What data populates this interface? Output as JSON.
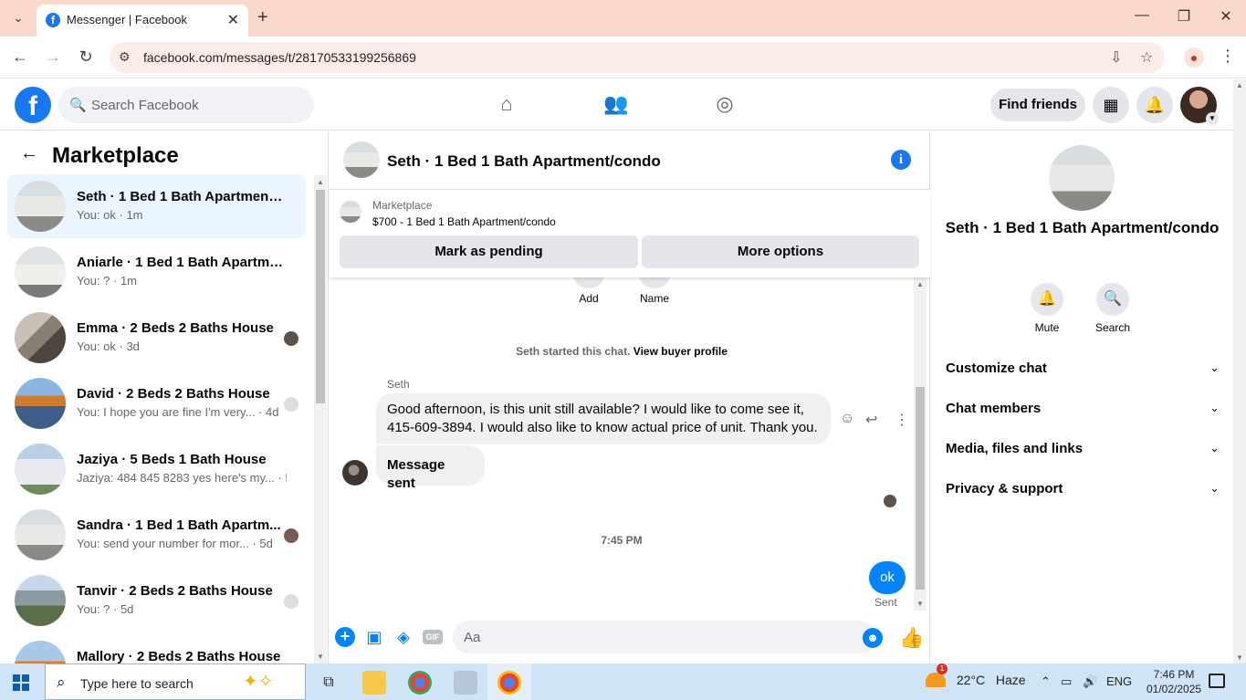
{
  "browser": {
    "tab_title": "Messenger | Facebook",
    "url": "facebook.com/messages/t/28170533199256869"
  },
  "fb": {
    "search_placeholder": "Search Facebook",
    "find_friends": "Find friends"
  },
  "left": {
    "title": "Marketplace",
    "conversations": [
      {
        "name": "Seth · 1 Bed 1 Bath Apartment/c...",
        "preview": "You: ok · 1m",
        "active": true
      },
      {
        "name": "Aniarle · 1 Bed 1 Bath Apartmen...",
        "preview": "You: ? · 1m"
      },
      {
        "name": "Emma · 2 Beds 2 Baths House",
        "preview": "You: ok · 3d"
      },
      {
        "name": "David · 2 Beds 2 Baths House",
        "preview": "You: I hope you are fine I'm very... · 4d"
      },
      {
        "name": "Jaziya · 5 Beds 1 Bath House",
        "preview": "Jaziya: 484 845 8283 yes here's my... · 5d"
      },
      {
        "name": "Sandra · 1 Bed 1 Bath Apartm...",
        "preview": "You: send your number for mor... · 5d"
      },
      {
        "name": "Tanvir · 2 Beds 2 Baths House",
        "preview": "You: ? · 5d"
      },
      {
        "name": "Mallory · 2 Beds 2 Baths House",
        "preview": ""
      }
    ]
  },
  "chat": {
    "title": "Seth · 1 Bed 1 Bath Apartment/condo",
    "marketplace_label": "Marketplace",
    "listing": "$700 - 1 Bed 1 Bath Apartment/condo",
    "mark_pending": "Mark as pending",
    "more_options": "More options",
    "quick_actions": {
      "add": "Add",
      "name": "Name"
    },
    "system_message": "Seth started this chat.",
    "view_buyer_profile": "View buyer profile",
    "sender": "Seth",
    "message1": "Good afternoon, is this unit still available? I would like to come see it, 415-609-3894. I would also like to know actual price of unit. Thank you.",
    "message2": "Message sent",
    "timestamp": "7:45 PM",
    "my_message": "ok",
    "sent_label": "Sent",
    "composer_placeholder": "Aa",
    "gif_label": "GIF"
  },
  "right": {
    "name": "Seth · 1 Bed 1 Bath Apartment/condo",
    "mute": "Mute",
    "search": "Search",
    "sections": [
      "Customize chat",
      "Chat members",
      "Media, files and links",
      "Privacy & support"
    ]
  },
  "taskbar": {
    "search_placeholder": "Type here to search",
    "weather_temp": "22°C",
    "weather_cond": "Haze",
    "weather_badge": "1",
    "lang": "ENG",
    "time": "7:46 PM",
    "date": "01/02/2025"
  },
  "colors": {
    "fb_blue": "#1877f2",
    "messenger_blue": "#0084ff",
    "browser_tab_bg": "#fad8cc"
  }
}
